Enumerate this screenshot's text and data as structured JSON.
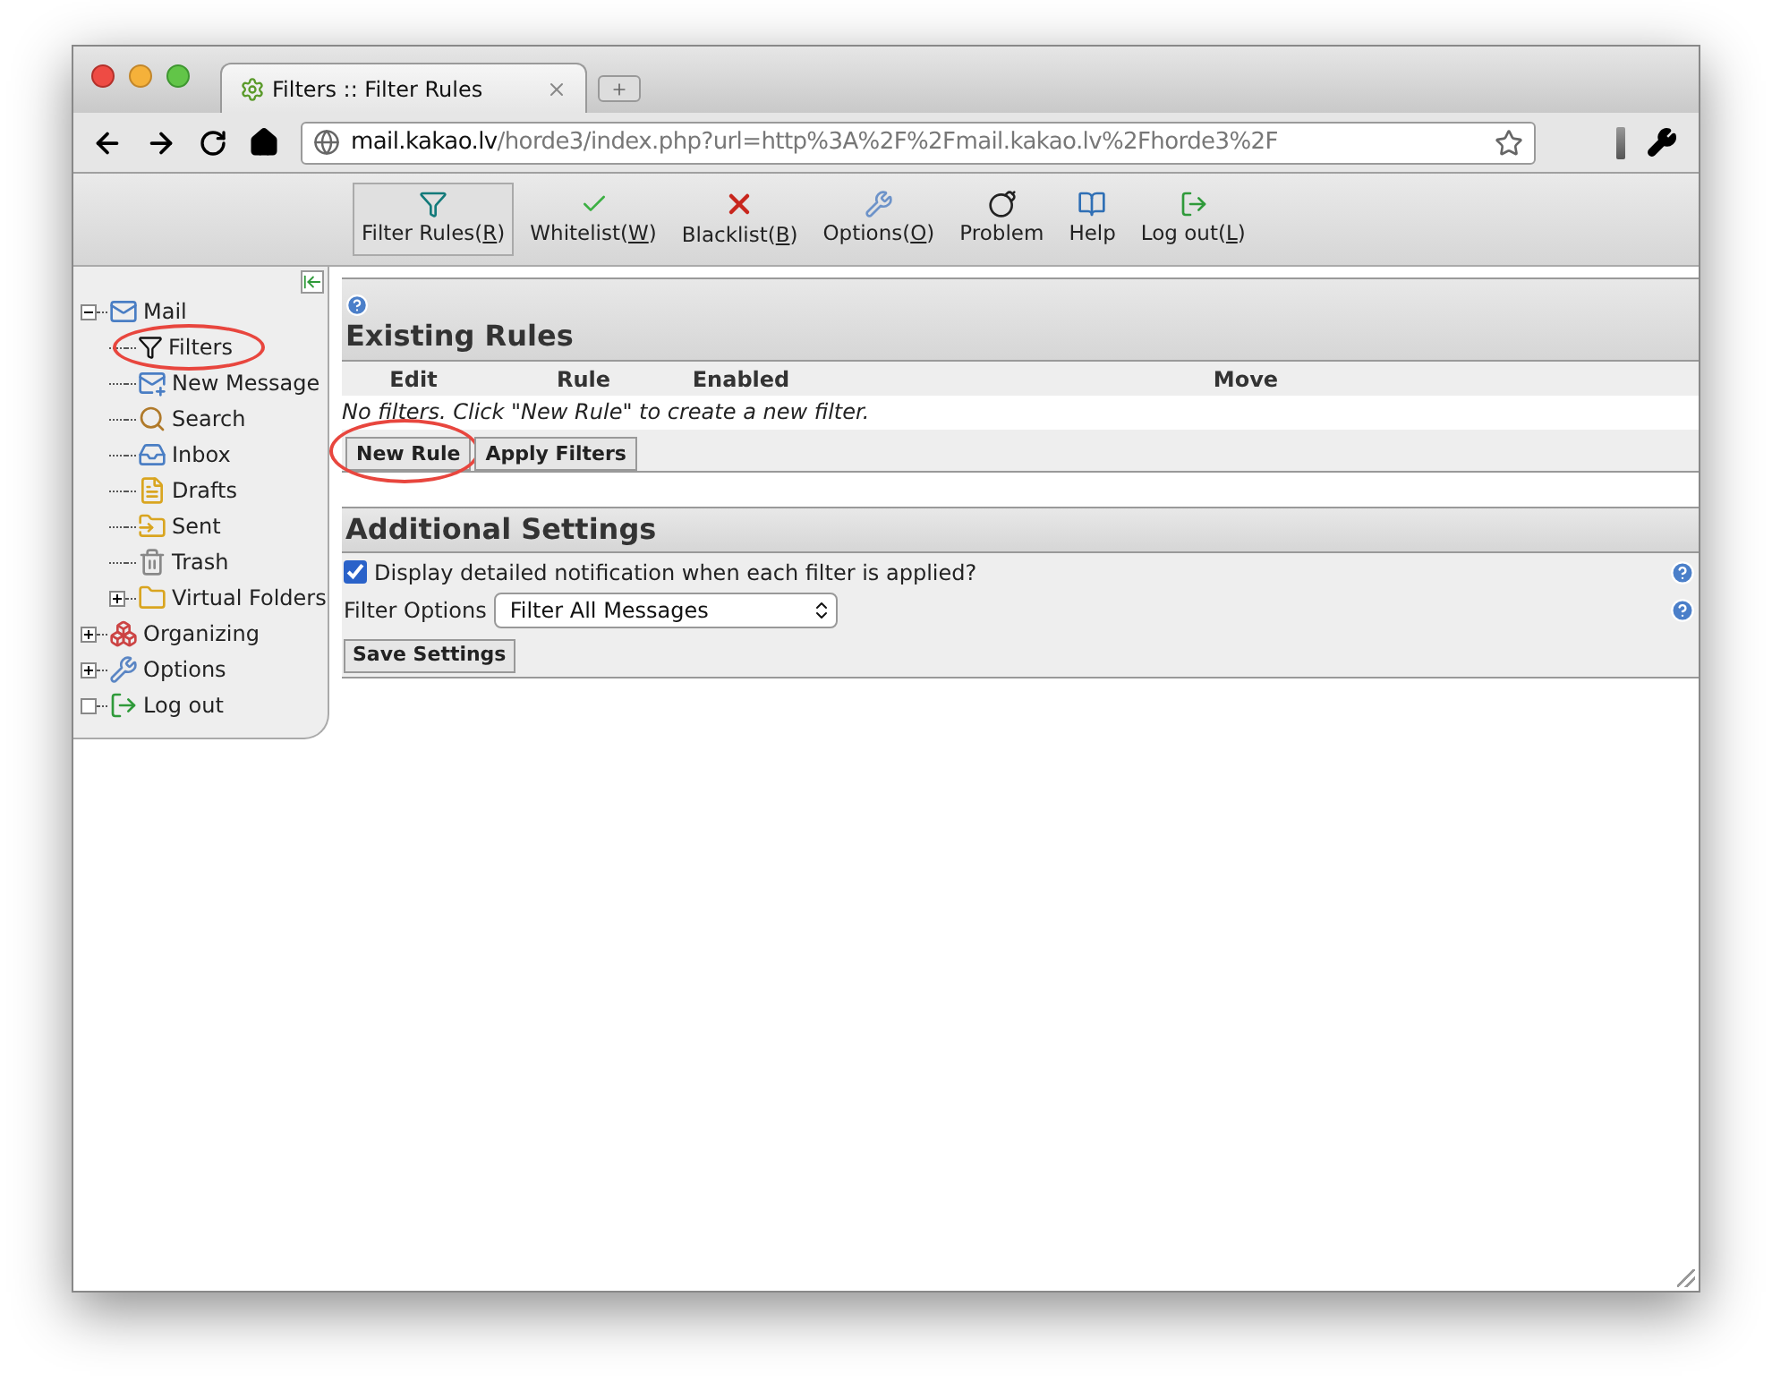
{
  "browser": {
    "tab": {
      "title": "Filters :: Filter Rules"
    },
    "url": {
      "host": "mail.kakao.lv",
      "path": "/horde3/index.php?url=http%3A%2F%2Fmail.kakao.lv%2Fhorde3%2F"
    }
  },
  "toolbar": [
    {
      "kind": "filter",
      "before": "Filter Rules(",
      "key": "R",
      "after": ")",
      "selected": true
    },
    {
      "kind": "check",
      "before": "Whitelist(",
      "key": "W",
      "after": ")",
      "selected": false
    },
    {
      "kind": "cross",
      "before": "Blacklist(",
      "key": "B",
      "after": ")",
      "selected": false
    },
    {
      "kind": "wrench",
      "before": "Options(",
      "key": "O",
      "after": ")",
      "selected": false
    },
    {
      "kind": "bomb",
      "before": "Problem",
      "selected": false
    },
    {
      "kind": "book",
      "before": "Help",
      "selected": false
    },
    {
      "kind": "exit",
      "before": "Log out(",
      "key": "L",
      "after": ")",
      "selected": false
    }
  ],
  "sidebar": {
    "items": [
      {
        "kind": "mail",
        "label": "Mail",
        "expanded": true,
        "highlighted": false,
        "children": [
          {
            "kind": "filter",
            "label": "Filters",
            "highlighted": true
          },
          {
            "kind": "compose",
            "label": "New Message",
            "highlighted": false
          },
          {
            "kind": "search",
            "label": "Search",
            "highlighted": false
          },
          {
            "kind": "inbox",
            "label": "Inbox",
            "highlighted": false
          },
          {
            "kind": "drafts",
            "label": "Drafts",
            "highlighted": false
          },
          {
            "kind": "sent",
            "label": "Sent",
            "highlighted": false
          },
          {
            "kind": "trash",
            "label": "Trash",
            "highlighted": false
          },
          {
            "kind": "folder",
            "label": "Virtual Folders",
            "expanded": false,
            "highlighted": false
          }
        ]
      },
      {
        "kind": "organizing",
        "label": "Organizing",
        "expanded": false,
        "highlighted": false
      },
      {
        "kind": "options",
        "label": "Options",
        "expanded": false,
        "highlighted": false
      },
      {
        "kind": "logout",
        "label": "Log out",
        "highlighted": false
      }
    ]
  },
  "rules": {
    "title": "Existing Rules",
    "columns": [
      "Edit",
      "Rule",
      "Enabled",
      "Move"
    ],
    "empty_message": "No filters. Click \"New Rule\" to create a new filter.",
    "buttons": [
      {
        "label": "New Rule",
        "highlighted": true
      },
      {
        "label": "Apply Filters",
        "highlighted": false
      }
    ]
  },
  "settings": {
    "title": "Additional Settings",
    "notify": {
      "label": "Display detailed notification when each filter is applied?",
      "checked": true
    },
    "filter_options": {
      "label": "Filter Options",
      "value": "Filter All Messages"
    },
    "save": "Save Settings"
  }
}
